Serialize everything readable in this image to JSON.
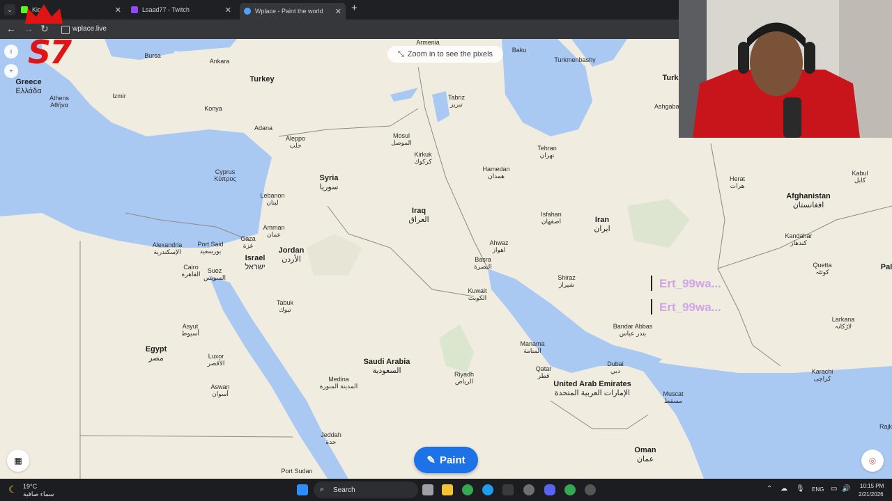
{
  "tabs": [
    {
      "label": "Kic"
    },
    {
      "label": "Lsaad77 - Twitch"
    },
    {
      "label": "Wplace - Paint the world"
    }
  ],
  "address": {
    "url": "wplace.live"
  },
  "map": {
    "zoom_hint": "Zoom in to see the pixels",
    "paint_label": "Paint",
    "side_buttons": [
      "i",
      "+"
    ],
    "countries": [
      {
        "name": "Turkey"
      },
      {
        "name": "Syria",
        "native": "سوريا"
      },
      {
        "name": "Iraq",
        "native": "العراق"
      },
      {
        "name": "Iran",
        "native": "ایران"
      },
      {
        "name": "Afghanistan",
        "native": "افغانستان"
      },
      {
        "name": "Jordan",
        "native": "الأردن"
      },
      {
        "name": "Israel",
        "native": "ישראל"
      },
      {
        "name": "Egypt",
        "native": "مصر"
      },
      {
        "name": "Saudi Arabia",
        "native": "السعودية"
      },
      {
        "name": "United Arab Emirates",
        "native": "الإمارات العربية المتحدة"
      },
      {
        "name": "Oman",
        "native": "عمان"
      },
      {
        "name": "Greece",
        "native": "Ελλάδα"
      },
      {
        "name": "Turk"
      },
      {
        "name": "Pal"
      }
    ],
    "cities": [
      {
        "name": "Bursa"
      },
      {
        "name": "Ankara"
      },
      {
        "name": "Izmir"
      },
      {
        "name": "Athens",
        "native": "Αθήνα"
      },
      {
        "name": "Konya"
      },
      {
        "name": "Adana"
      },
      {
        "name": "Aleppo",
        "native": "حلب"
      },
      {
        "name": "Mosul",
        "native": "الموصل"
      },
      {
        "name": "Kirkuk",
        "native": "كركوك"
      },
      {
        "name": "Tabriz",
        "native": "تبریز"
      },
      {
        "name": "Baku"
      },
      {
        "name": "Armenia"
      },
      {
        "name": "Turkmenbashy"
      },
      {
        "name": "Tehran",
        "native": "تهران"
      },
      {
        "name": "Ashgabat"
      },
      {
        "name": "Hamedan",
        "native": "همدان"
      },
      {
        "name": "Herat",
        "native": "هرات"
      },
      {
        "name": "Kabul",
        "native": "کابل"
      },
      {
        "name": "Cyprus",
        "native": "Κύπρος"
      },
      {
        "name": "Lebanon",
        "native": "لبنان"
      },
      {
        "name": "Amman",
        "native": "عمان"
      },
      {
        "name": "Gaza",
        "native": "غزة"
      },
      {
        "name": "Alexandria",
        "native": "الإسكندرية"
      },
      {
        "name": "Port Said",
        "native": "بورسعيد"
      },
      {
        "name": "Cairo",
        "native": "القاهرة"
      },
      {
        "name": "Suez",
        "native": "السويس"
      },
      {
        "name": "Isfahan",
        "native": "اصفهان"
      },
      {
        "name": "Ahwaz",
        "native": "اهواز"
      },
      {
        "name": "Basra",
        "native": "البصرة"
      },
      {
        "name": "Kandahar",
        "native": "کندهار"
      },
      {
        "name": "Quetta",
        "native": "کوئٹہ"
      },
      {
        "name": "Shiraz",
        "native": "شیراز"
      },
      {
        "name": "Kuwait",
        "native": "الكويت"
      },
      {
        "name": "Tabuk",
        "native": "تبوك"
      },
      {
        "name": "Asyut",
        "native": "أسيوط"
      },
      {
        "name": "Luxor",
        "native": "الأقصر"
      },
      {
        "name": "Aswan",
        "native": "أسوان"
      },
      {
        "name": "Medina",
        "native": "المدينة المنورة"
      },
      {
        "name": "Riyadh",
        "native": "الرياض"
      },
      {
        "name": "Manama",
        "native": "المنامة"
      },
      {
        "name": "Qatar",
        "native": "قطر"
      },
      {
        "name": "Dubai",
        "native": "دبي"
      },
      {
        "name": "Bandar Abbas",
        "native": "بندر عباس"
      },
      {
        "name": "Muscat",
        "native": "مسقط"
      },
      {
        "name": "Larkana",
        "native": "لاڑکانہ"
      },
      {
        "name": "Karachi",
        "native": "کراچی"
      },
      {
        "name": "Jeddah",
        "native": "جدة"
      },
      {
        "name": "Port Sudan"
      },
      {
        "name": "Rajk"
      }
    ],
    "chat_overlay": [
      {
        "name": "Ert_99wa..."
      },
      {
        "name": "Ert_99wa..."
      }
    ]
  },
  "overlay": {
    "brand_text": "S7"
  },
  "taskbar": {
    "temperature": "19°C",
    "weather_desc": "سماء صافية",
    "search_label": "Search",
    "language": "ENG",
    "time": "10:15 PM",
    "date": "2/21/2026"
  }
}
